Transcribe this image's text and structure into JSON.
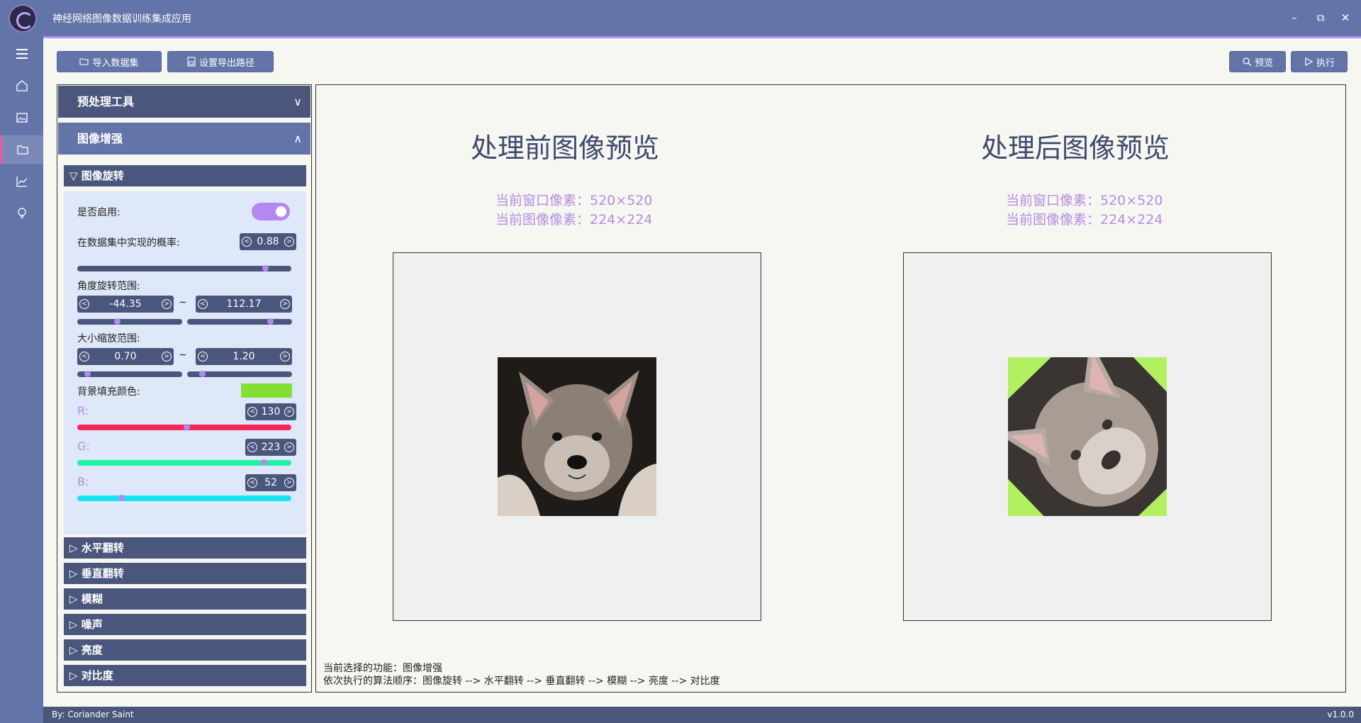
{
  "app": {
    "title": "神经网络图像数据训练集成应用",
    "footer_author": "By: Coriander Saint",
    "version": "v1.0.0"
  },
  "toolbar": {
    "import_label": "导入数据集",
    "export_label": "设置导出路径",
    "preview_label": "预览",
    "run_label": "执行"
  },
  "left": {
    "section1": "预处理工具",
    "section2": "图像增强",
    "rotate": {
      "title": "图像旋转",
      "enable_label": "是否启用:",
      "enabled": true,
      "prob_label": "在数据集中实现的概率:",
      "prob": "0.88",
      "prob_fraction": 0.88,
      "angle_label": "角度旋转范围:",
      "angle_min": "-44.35",
      "angle_max": "112.17",
      "tilde": "~",
      "scale_label": "大小缩放范围:",
      "scale_min": "0.70",
      "scale_max": "1.20",
      "fill_label": "背景填充颜色:",
      "fill_color": "#82df34",
      "r_label": "R:",
      "r": "130",
      "r_value": 130,
      "g_label": "G:",
      "g": "223",
      "g_value": 223,
      "b_label": "B:",
      "b": "52",
      "b_value": 52
    },
    "more": [
      "水平翻转",
      "垂直翻转",
      "模糊",
      "噪声",
      "亮度",
      "对比度"
    ]
  },
  "preview": {
    "before_title": "处理前图像预览",
    "after_title": "处理后图像预览",
    "window_px": "当前窗口像素：520×520",
    "image_px": "当前图像像素：224×224",
    "window_px_after": "当前窗口像素：520×520",
    "image_px_after": "当前图像像素：224×224"
  },
  "status": {
    "selected": "当前选择的功能：图像增强",
    "order": "依次执行的算法顺序：图像旋转 --> 水平翻转 --> 垂直翻转 --> 模糊 --> 亮度 --> 对比度"
  },
  "colors": {
    "accent": "#6374a8",
    "dark": "#4a567c",
    "purple": "#b388f0",
    "red": "#f7265a",
    "green": "#22f2a6",
    "cyan": "#18e4f0"
  }
}
